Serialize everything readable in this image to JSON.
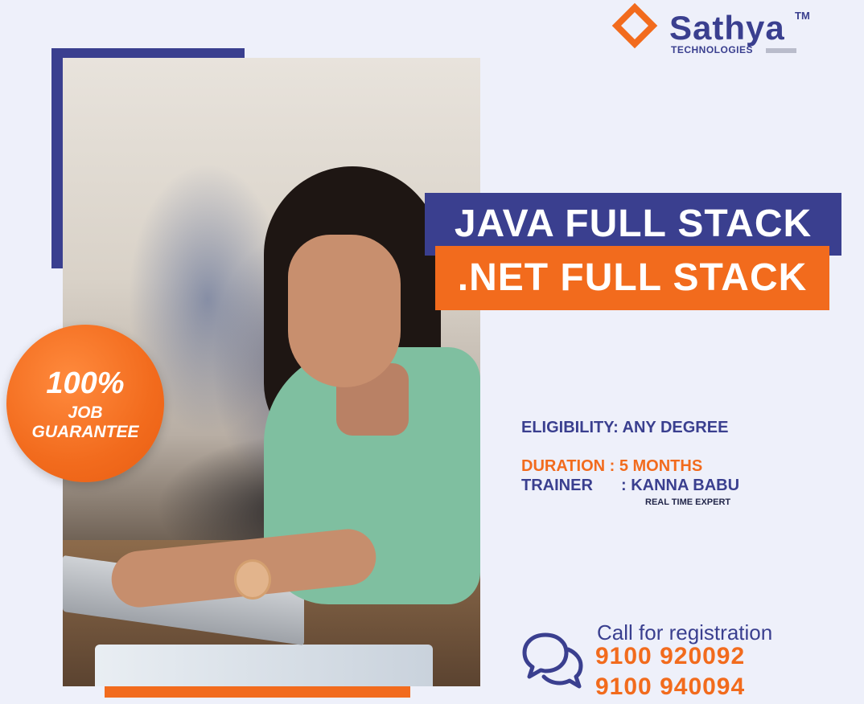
{
  "brand": {
    "name": "Sathya",
    "trademark": "TM",
    "subtitle": "TECHNOLOGIES",
    "colors": {
      "primary": "#3a3f8f",
      "accent": "#f26b1d"
    }
  },
  "badge": {
    "percent": "100%",
    "line1": "JOB",
    "line2": "GUARANTEE"
  },
  "courses": [
    "JAVA FULL STACK",
    ".NET FULL STACK"
  ],
  "details": {
    "eligibility": "ELIGIBILITY: ANY DEGREE",
    "duration": "DURATION : 5 MONTHS",
    "trainer_label": "TRAINER",
    "trainer_value": ": KANNA BABU",
    "trainer_note": "REAL TIME EXPERT"
  },
  "contact": {
    "label": "Call for registration",
    "phones": [
      "9100 920092",
      "9100 940094"
    ],
    "icon": "chat-bubbles-icon"
  }
}
